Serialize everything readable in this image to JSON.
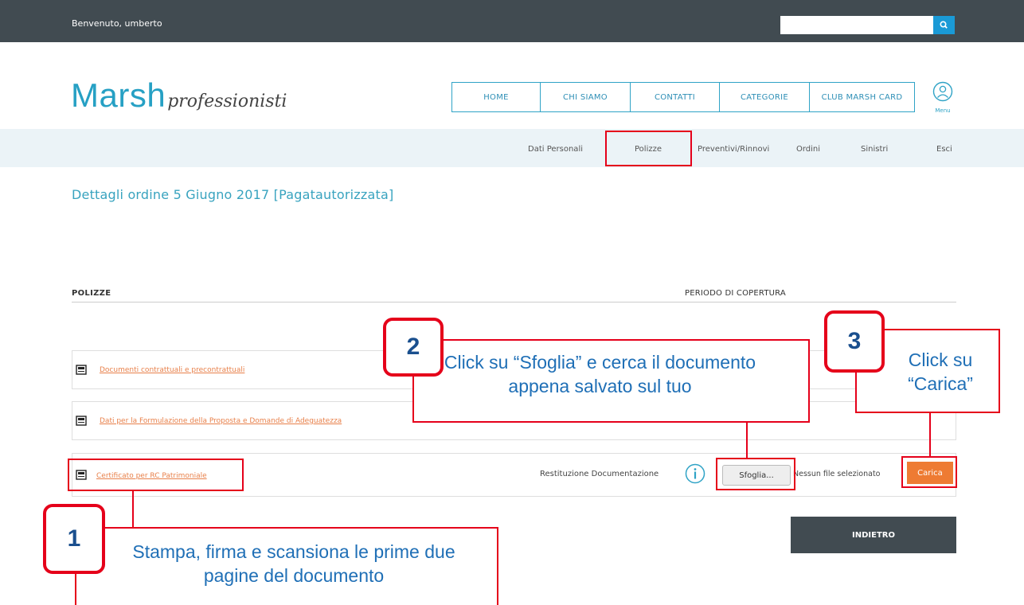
{
  "topbar": {
    "welcome": "Benvenuto, umberto",
    "search_placeholder": "",
    "search_icon": "search-icon"
  },
  "logo": {
    "main": "Marsh",
    "sub": "professionisti"
  },
  "main_nav": [
    {
      "label": "HOME"
    },
    {
      "label": "CHI SIAMO"
    },
    {
      "label": "CONTATTI"
    },
    {
      "label": "CATEGORIE"
    },
    {
      "label": "CLUB MARSH CARD"
    }
  ],
  "menu": {
    "label": "Menu",
    "icon": "user-icon"
  },
  "sub_nav": [
    {
      "label": "Dati Personali"
    },
    {
      "label": "Polizze"
    },
    {
      "label": "Preventivi/Rinnovi"
    },
    {
      "label": "Ordini"
    },
    {
      "label": "Sinistri"
    },
    {
      "label": "Esci"
    }
  ],
  "page": {
    "title": "Dettagli ordine 5 Giugno 2017 [Pagatautorizzata]"
  },
  "table": {
    "headers": {
      "polizze": "POLIZZE",
      "periodo": "PERIODO DI COPERTURA"
    },
    "documents": [
      {
        "label": "Documenti contrattuali e precontrattuali"
      },
      {
        "label": "Dati per la Formulazione della Proposta e Domande di Adeguatezza"
      },
      {
        "label": "Certificato per RC Patrimoniale"
      }
    ]
  },
  "upload": {
    "restituzione": "Restituzione Documentazione",
    "browse": "Sfoglia...",
    "no_file": "Nessun file selezionato",
    "upload": "Carica"
  },
  "back_button": "INDIETRO",
  "annotations": [
    {
      "number": "1",
      "text": "Stampa, firma e scansiona le prime due pagine del documento"
    },
    {
      "number": "2",
      "text": "Click su “Sfoglia” e cerca il documento appena salvato sul tuo"
    },
    {
      "number": "3",
      "text": "Click su “Carica”"
    }
  ],
  "colors": {
    "accent": "#2fa3c6",
    "topbar": "#414b51",
    "orange": "#ee7b33",
    "highlight": "#e5001a"
  }
}
